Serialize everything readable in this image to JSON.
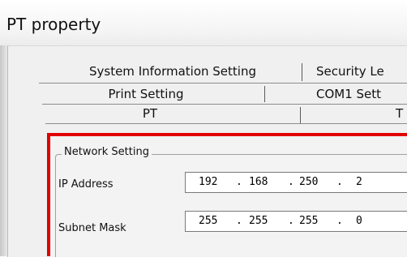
{
  "window": {
    "title": "PT property"
  },
  "tabs": {
    "row1": [
      "System Information Setting",
      "Security Le"
    ],
    "row2": [
      "Print Setting",
      "COM1 Sett"
    ],
    "row3": [
      "PT",
      "T"
    ]
  },
  "network": {
    "group_title": "Network Setting",
    "ip_label": "IP Address",
    "ip_octets": [
      "192",
      "168",
      "250",
      "2"
    ],
    "subnet_label": "Subnet Mask",
    "subnet_octets": [
      "255",
      "255",
      "255",
      "0"
    ],
    "dot": "."
  },
  "colors": {
    "highlight": "#e00000"
  }
}
